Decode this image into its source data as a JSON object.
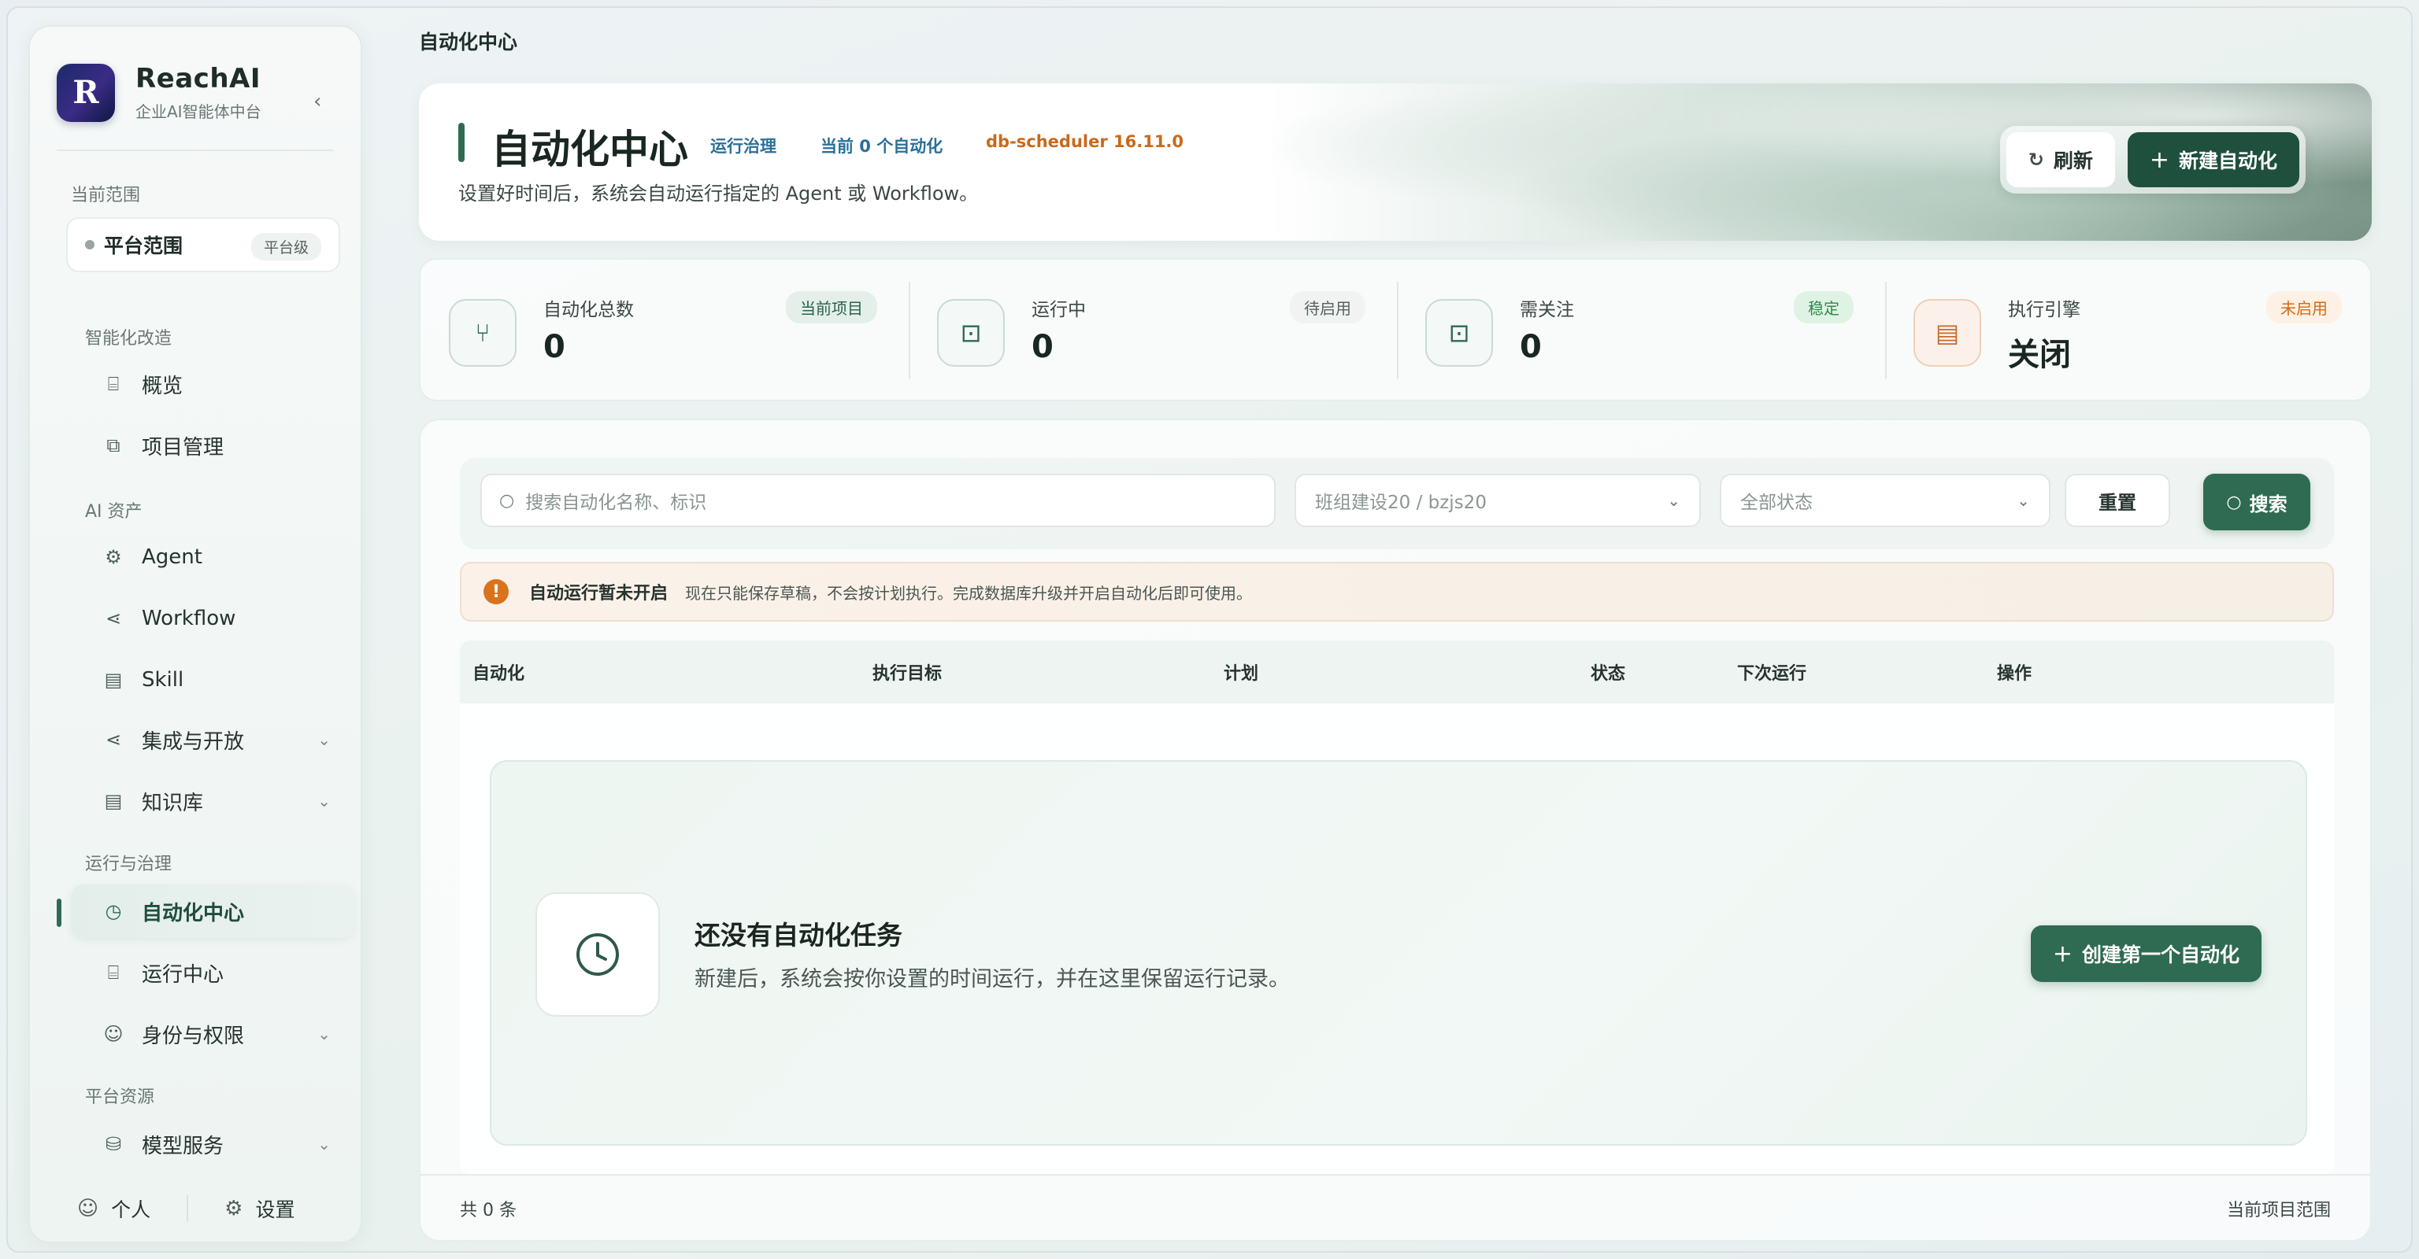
{
  "brand": {
    "name": "ReachAI",
    "subtitle": "企业AI智能体中台"
  },
  "sidebar": {
    "scope_label": "当前范围",
    "scope_name": "平台范围",
    "scope_badge": "平台级",
    "groups": [
      "智能化改造",
      "AI 资产",
      "运行与治理",
      "平台资源"
    ],
    "items": [
      {
        "label": "概览",
        "icon": "presentation-icon"
      },
      {
        "label": "项目管理",
        "icon": "projects-icon"
      },
      {
        "label": "Agent",
        "icon": "chip-icon"
      },
      {
        "label": "Workflow",
        "icon": "share-icon"
      },
      {
        "label": "Skill",
        "icon": "book-icon"
      },
      {
        "label": "集成与开放",
        "icon": "share-icon"
      },
      {
        "label": "知识库",
        "icon": "book-icon"
      },
      {
        "label": "自动化中心",
        "icon": "timer-icon"
      },
      {
        "label": "运行中心",
        "icon": "presentation-icon"
      },
      {
        "label": "身份与权限",
        "icon": "user-icon"
      },
      {
        "label": "模型服务",
        "icon": "database-icon"
      }
    ],
    "footer": {
      "personal": "个人",
      "settings": "设置"
    }
  },
  "breadcrumb": "自动化中心",
  "hero": {
    "title": "自动化中心",
    "tag_governance": "运行治理",
    "tag_count": "当前 0 个自动化",
    "tag_scheduler": "db-scheduler 16.11.0",
    "description": "设置好时间后，系统会自动运行指定的 Agent 或 Workflow。",
    "refresh_label": "刷新",
    "new_label": "新建自动化"
  },
  "stats": [
    {
      "label": "自动化总数",
      "value": "0",
      "badge": "当前项目",
      "icon": "workflow-icon"
    },
    {
      "label": "运行中",
      "value": "0",
      "badge": "待启用",
      "icon": "robot-icon"
    },
    {
      "label": "需关注",
      "value": "0",
      "badge": "稳定",
      "icon": "robot-alert-icon"
    },
    {
      "label": "执行引擎",
      "value": "关闭",
      "badge": "未启用",
      "icon": "engine-icon"
    }
  ],
  "filters": {
    "search_placeholder": "搜索自动化名称、标识",
    "project_select": "班组建设20 / bzjs20",
    "status_select": "全部状态",
    "reset_label": "重置",
    "search_label": "搜索"
  },
  "alert": {
    "title": "自动运行暂未开启",
    "text": "现在只能保存草稿，不会按计划执行。完成数据库升级并开启自动化后即可使用。"
  },
  "table": {
    "columns": [
      "自动化",
      "执行目标",
      "计划",
      "状态",
      "下次运行",
      "操作"
    ]
  },
  "empty": {
    "title": "还没有自动化任务",
    "description": "新建后，系统会按你设置的时间运行，并在这里保留运行记录。",
    "create_label": "创建第一个自动化"
  },
  "footer": {
    "total": "共 0 条",
    "scope": "当前项目范围"
  },
  "colors": {
    "primary": "#2f6b52",
    "dark_primary": "#1f4f3d",
    "warning": "#d9731e"
  }
}
